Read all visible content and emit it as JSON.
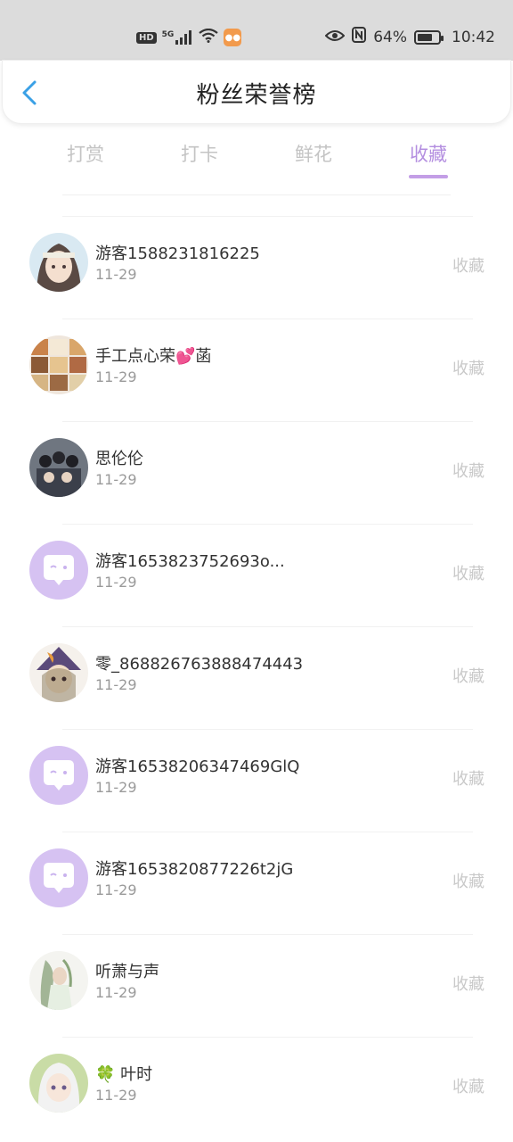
{
  "status": {
    "hd": "HD",
    "network": "5G",
    "battery": "64%",
    "time": "10:42"
  },
  "header": {
    "title": "粉丝荣誉榜"
  },
  "tabs": [
    {
      "label": "打赏"
    },
    {
      "label": "打卡"
    },
    {
      "label": "鲜花"
    },
    {
      "label": "收藏"
    }
  ],
  "active_tab": "收藏",
  "colors": {
    "accent": "#b48fe0",
    "placeholder_avatar": "#d6c2f2",
    "back_arrow": "#3aa0e6"
  },
  "fans": [
    {
      "name": "游客1588231816225",
      "date": "11-29",
      "action": "收藏",
      "avatar": "anime-girl"
    },
    {
      "name": "手工点心荣💕菡",
      "date": "11-29",
      "action": "收藏",
      "avatar": "food-collage"
    },
    {
      "name": "思伦伦",
      "date": "11-29",
      "action": "收藏",
      "avatar": "group-photo"
    },
    {
      "name": "游客1653823752693o...",
      "date": "11-29",
      "action": "收藏",
      "avatar": "default-chat"
    },
    {
      "name": "零_868826763888474443",
      "date": "11-29",
      "action": "收藏",
      "avatar": "anime-witch"
    },
    {
      "name": "游客16538206347469GlQ",
      "date": "11-29",
      "action": "收藏",
      "avatar": "default-chat"
    },
    {
      "name": "游客1653820877226t2jG",
      "date": "11-29",
      "action": "收藏",
      "avatar": "default-chat"
    },
    {
      "name": "听萧与声",
      "date": "11-29",
      "action": "收藏",
      "avatar": "ink-painting"
    },
    {
      "name": "🍀 叶时",
      "date": "11-29",
      "action": "收藏",
      "avatar": "anime-white-hair"
    }
  ]
}
